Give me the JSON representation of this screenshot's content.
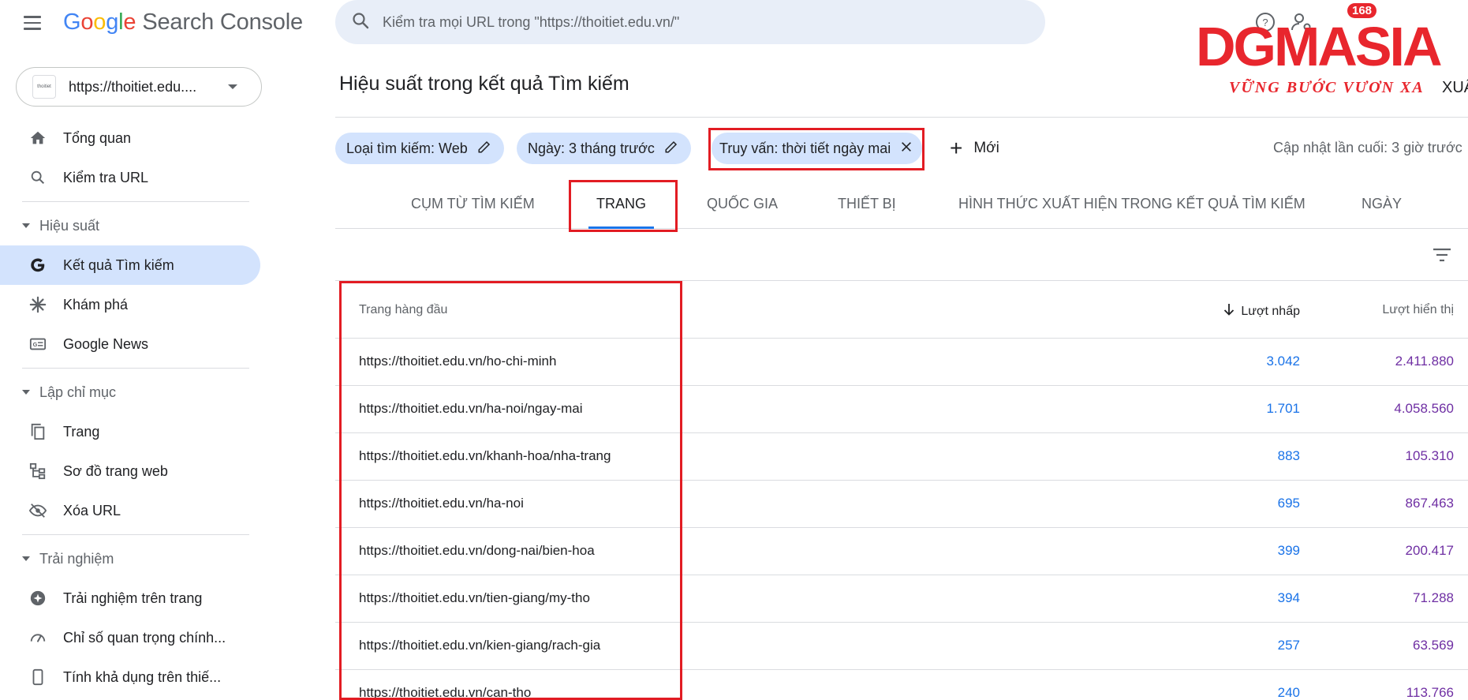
{
  "app": {
    "logo_letters": [
      "G",
      "o",
      "o",
      "g",
      "l",
      "e"
    ],
    "product": "Search Console"
  },
  "search": {
    "placeholder": "Kiểm tra mọi URL trong \"https://thoitiet.edu.vn/\""
  },
  "property": {
    "url": "https://thoitiet.edu....",
    "favicon_text": "thoitiet"
  },
  "brand": {
    "word": "DGMASIA",
    "badge": "168",
    "slogan": "VỮNG BƯỚC VƯƠN XA",
    "cut_text": "XUẤ"
  },
  "sidebar": {
    "items": [
      {
        "label": "Tổng quan",
        "icon": "home-icon"
      },
      {
        "label": "Kiểm tra URL",
        "icon": "search-icon"
      }
    ],
    "sections": [
      {
        "label": "Hiệu suất",
        "items": [
          {
            "label": "Kết quả Tìm kiếm",
            "icon": "google-g-icon",
            "active": true
          },
          {
            "label": "Khám phá",
            "icon": "asterisk-icon"
          },
          {
            "label": "Google News",
            "icon": "news-icon"
          }
        ]
      },
      {
        "label": "Lập chỉ mục",
        "items": [
          {
            "label": "Trang",
            "icon": "pages-icon"
          },
          {
            "label": "Sơ đồ trang web",
            "icon": "sitemap-icon"
          },
          {
            "label": "Xóa URL",
            "icon": "eye-off-icon"
          }
        ]
      },
      {
        "label": "Trải nghiệm",
        "items": [
          {
            "label": "Trải nghiệm trên trang",
            "icon": "plus-circle-icon"
          },
          {
            "label": "Chỉ số quan trọng chính...",
            "icon": "gauge-icon"
          },
          {
            "label": "Tính khả dụng trên thiế...",
            "icon": "mobile-icon"
          }
        ]
      }
    ]
  },
  "main": {
    "title": "Hiệu suất trong kết quả Tìm kiếm",
    "chips": [
      {
        "label": "Loại tìm kiếm: Web"
      },
      {
        "label": "Ngày: 3 tháng trước"
      },
      {
        "label": "Truy vấn: thời tiết ngày mai"
      }
    ],
    "new_label": "Mới",
    "updated": "Cập nhật lần cuối: 3 giờ trước",
    "tabs": [
      {
        "label": "CỤM TỪ TÌM KIẾM"
      },
      {
        "label": "TRANG",
        "active": true
      },
      {
        "label": "QUỐC GIA"
      },
      {
        "label": "THIẾT BỊ"
      },
      {
        "label": "HÌNH THỨC XUẤT HIỆN TRONG KẾT QUẢ TÌM KIẾM"
      },
      {
        "label": "NGÀY"
      }
    ],
    "table": {
      "headers": {
        "page": "Trang hàng đầu",
        "clicks": "Lượt nhấp",
        "impressions": "Lượt hiển thị"
      },
      "rows": [
        {
          "url": "https://thoitiet.edu.vn/ho-chi-minh",
          "clicks": "3.042",
          "impressions": "2.411.880"
        },
        {
          "url": "https://thoitiet.edu.vn/ha-noi/ngay-mai",
          "clicks": "1.701",
          "impressions": "4.058.560"
        },
        {
          "url": "https://thoitiet.edu.vn/khanh-hoa/nha-trang",
          "clicks": "883",
          "impressions": "105.310"
        },
        {
          "url": "https://thoitiet.edu.vn/ha-noi",
          "clicks": "695",
          "impressions": "867.463"
        },
        {
          "url": "https://thoitiet.edu.vn/dong-nai/bien-hoa",
          "clicks": "399",
          "impressions": "200.417"
        },
        {
          "url": "https://thoitiet.edu.vn/tien-giang/my-tho",
          "clicks": "394",
          "impressions": "71.288"
        },
        {
          "url": "https://thoitiet.edu.vn/kien-giang/rach-gia",
          "clicks": "257",
          "impressions": "63.569"
        },
        {
          "url": "https://thoitiet.edu.vn/can-tho",
          "clicks": "240",
          "impressions": "113.766"
        }
      ]
    }
  },
  "colors": {
    "accent": "#1a73e8",
    "active_bg": "#d3e3fd",
    "clicks": "#1a73e8",
    "impressions": "#6f2fa3",
    "highlight": "#e21c23",
    "brand": "#e8262d"
  }
}
